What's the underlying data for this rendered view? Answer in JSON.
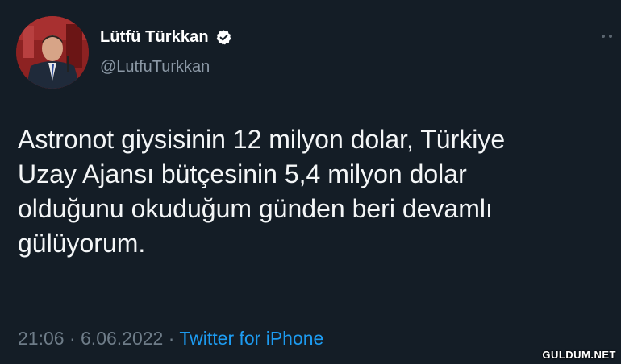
{
  "author": {
    "display_name": "Lütfü Türkkan",
    "handle": "@LutfuTurkkan",
    "verified": true
  },
  "tweet": {
    "text": "Astronot giysisinin 12 milyon dolar, Türkiye\nUzay Ajansı bütçesinin 5,4 milyon dolar\nolduğunu okuduğum günden beri devamlı\ngülüyorum."
  },
  "meta": {
    "time": "21:06",
    "separator": " · ",
    "date": "6.06.2022",
    "source": "Twitter for iPhone"
  },
  "icons": {
    "verified": "verified-badge-icon",
    "more": "more-options-icon"
  },
  "watermark": "GULDUM.NET",
  "colors": {
    "background": "#141d26",
    "link": "#1d9bf0",
    "muted": "#8b98a5"
  }
}
